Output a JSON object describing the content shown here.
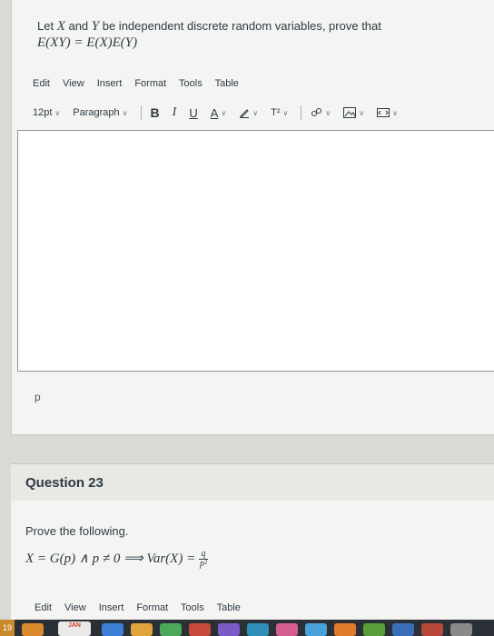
{
  "question1": {
    "prompt_prefix": "Let ",
    "var_x": "X",
    "and_word": " and ",
    "var_y": "Y",
    "prompt_suffix": " be independent discrete random variables, prove that",
    "formula": "E(XY) = E(X)E(Y)"
  },
  "editor_menu": [
    "Edit",
    "View",
    "Insert",
    "Format",
    "Tools",
    "Table"
  ],
  "toolbar": {
    "font_size": "12pt",
    "block_format": "Paragraph",
    "bold": "B",
    "italic": "I",
    "underline": "U",
    "text_color": "A",
    "superscript": "T²"
  },
  "status_path": "p",
  "question23": {
    "title": "Question 23",
    "prompt": "Prove the following.",
    "formula_lhs": "X = G(p) ∧ p ≠ 0 ⟹ Var(X) = ",
    "frac_num": "q",
    "frac_den": "p²"
  },
  "taskbar": {
    "badge": "19",
    "calendar_label": "JAN"
  }
}
